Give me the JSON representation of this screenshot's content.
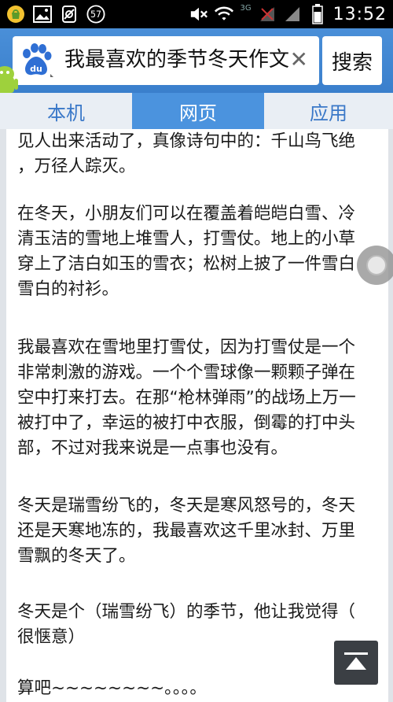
{
  "status_bar": {
    "notif_icons": [
      "shopping-bag-icon",
      "image-icon",
      "no-sim-icon",
      "battery-percent-badge-icon"
    ],
    "badge_value": "57",
    "network": "3G",
    "time": "13:52"
  },
  "search": {
    "query": "我最喜欢的季节冬天作文",
    "clear_symbol": "✕",
    "button_label": "搜索"
  },
  "tabs": [
    {
      "label": "本机",
      "active": false
    },
    {
      "label": "网页",
      "active": true
    },
    {
      "label": "应用",
      "active": false
    }
  ],
  "article": {
    "paragraphs": [
      "见人出来活动了，真像诗句中的：千山鸟飞绝\n，万径人踪灭。",
      "在冬天，小朋友们可以在覆盖着皑皑白雪、冷\n清玉洁的雪地上堆雪人，打雪仗。地上的小草\n穿上了洁白如玉的雪衣；松树上披了一件雪白\n雪白的衬衫。",
      "我最喜欢在雪地里打雪仗，因为打雪仗是一个\n非常刺激的游戏。一个个雪球像一颗颗子弹在\n空中打来打去。在那“枪林弹雨”的战场上万一\n被打中了，幸运的被打中衣服，倒霉的打中头\n部，不过对我来说是一点事也没有。",
      "冬天是瑞雪纷飞的，冬天是寒风怒号的，冬天\n还是天寒地冻的，我最喜欢这千里冰封、万里\n雪飘的冬天了。",
      "冬天是个（瑞雪纷飞）的季节，他让我觉得（\n很惬意）",
      "算吧~~~~~~~~。。。。"
    ]
  },
  "colors": {
    "accent_blue": "#4b93de",
    "tab_text": "#3a78c8",
    "status_bar": "#000000"
  }
}
